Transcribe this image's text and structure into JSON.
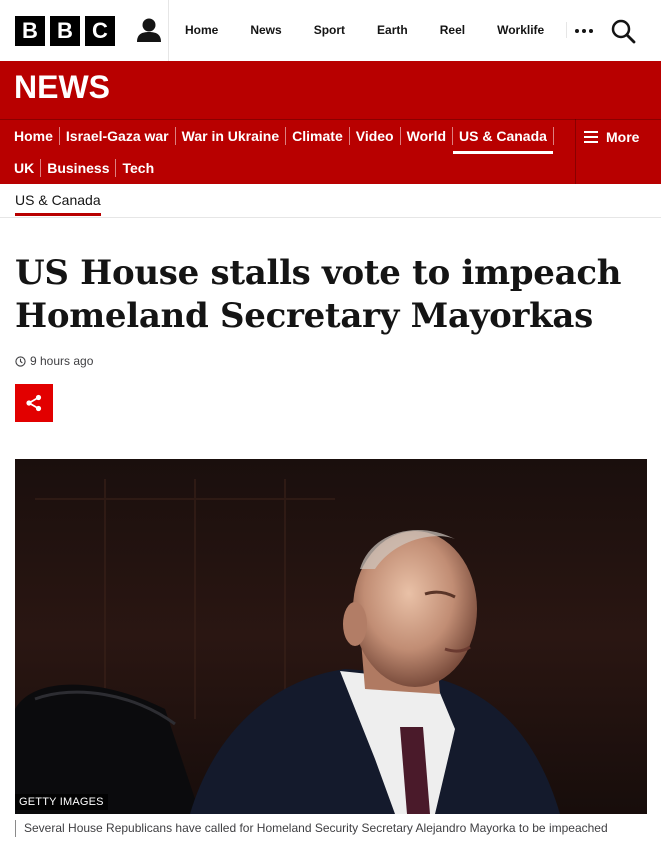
{
  "brand": {
    "letters": [
      "B",
      "B",
      "C"
    ]
  },
  "top_nav": {
    "items": [
      "Home",
      "News",
      "Sport",
      "Earth",
      "Reel",
      "Worklife"
    ]
  },
  "news_banner": {
    "title": "NEWS",
    "row1": [
      "Home",
      "Israel-Gaza war",
      "War in Ukraine",
      "Climate",
      "Video",
      "World",
      "US & Canada"
    ],
    "row2": [
      "UK",
      "Business",
      "Tech"
    ],
    "active": "US & Canada",
    "more_label": "More"
  },
  "section": {
    "label": "US & Canada"
  },
  "article": {
    "headline": "US House stalls vote to impeach Homeland Secretary Mayorkas",
    "timestamp": "9 hours ago",
    "image_credit": "GETTY IMAGES",
    "caption": "Several House Republicans have called for Homeland Security Secretary Alejandro Mayorka to be impeached"
  },
  "colors": {
    "brand_red": "#b80000",
    "share_red": "#e20000"
  },
  "icons": [
    "user-icon",
    "more-dots-icon",
    "search-icon",
    "hamburger-icon",
    "clock-icon",
    "share-icon"
  ]
}
